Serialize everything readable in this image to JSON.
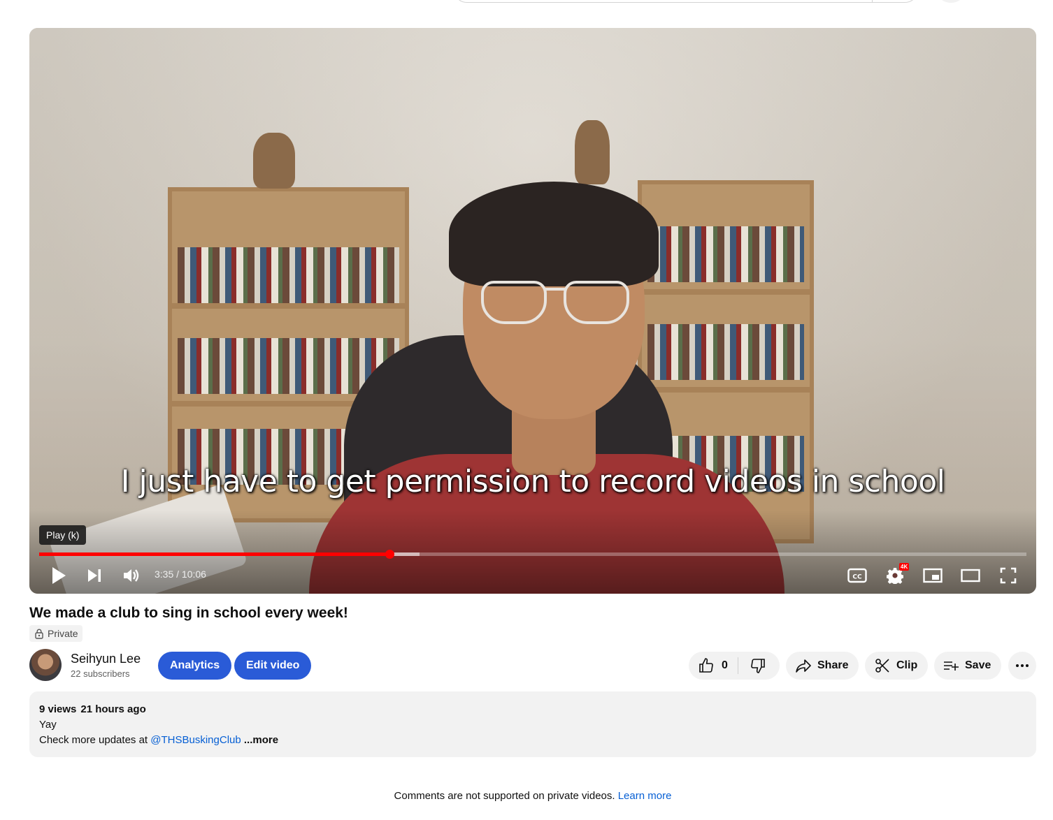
{
  "player": {
    "subtitle": "I just have to get permission to record videos in school",
    "tooltip": "Play (k)",
    "time_display": "3:35 / 10:06",
    "progress_played": 0.355,
    "progress_loaded": 0.385,
    "quality_badge": "4K",
    "icons": [
      "play-icon",
      "next-icon",
      "volume-icon",
      "cc-icon",
      "settings-icon",
      "miniplayer-icon",
      "theater-icon",
      "fullscreen-icon"
    ]
  },
  "video": {
    "title": "We made a club to sing in school every week!",
    "visibility": "Private"
  },
  "channel": {
    "name": "Seihyun Lee",
    "subscribers": "22 subscribers"
  },
  "actions": {
    "analytics": "Analytics",
    "edit_video": "Edit video",
    "like_count": "0",
    "share": "Share",
    "clip": "Clip",
    "save": "Save"
  },
  "description": {
    "views": "9 views",
    "age": "21 hours ago",
    "line1": "Yay",
    "line2_prefix": "Check more updates at ",
    "handle": "@THSBuskingClub",
    "more": " ...more"
  },
  "comments": {
    "note": "Comments are not supported on private videos. ",
    "learn_more": "Learn more"
  },
  "colors": {
    "progress": "#ff0000",
    "button_blue": "#2a5bd7",
    "link": "#065fd4",
    "chip_bg": "#f2f2f2"
  }
}
